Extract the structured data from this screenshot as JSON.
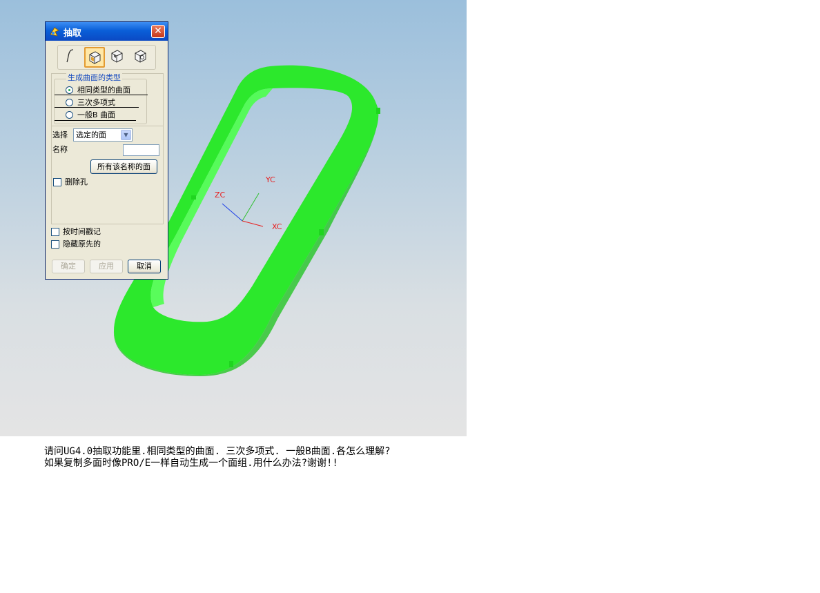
{
  "dialog": {
    "title": "抽取",
    "close_glyph": "✕",
    "toolbar": {
      "icons": [
        "curve-icon",
        "face-icon",
        "face-region-icon",
        "body-icon"
      ],
      "selected_index": 1
    },
    "surface_type": {
      "group_title": "生成曲面的类型",
      "options": [
        {
          "label": "相同类型的曲面",
          "checked": true
        },
        {
          "label": "三次多项式",
          "checked": false
        },
        {
          "label": "一般B 曲面",
          "checked": false
        }
      ]
    },
    "select_label": "选择",
    "select_value": "选定的面",
    "name_label": "名称",
    "name_value": "",
    "all_named_faces_button": "所有该名称的面",
    "delete_holes": {
      "label": "删除孔",
      "checked": false
    },
    "timestamp": {
      "label": "按时间戳记",
      "checked": false
    },
    "hide_original": {
      "label": "隐藏原先的",
      "checked": false
    },
    "buttons": {
      "ok": "确定",
      "apply": "应用",
      "cancel": "取消"
    }
  },
  "viewport": {
    "axes": {
      "x": "XC",
      "y": "YC",
      "z": "ZC"
    },
    "part_color": "#22ee22",
    "axis_colors": {
      "x": "#e81c1c",
      "y": "#2fbf2f",
      "z": "#1c3ee8"
    }
  },
  "question": {
    "line1": "请问UG4.0抽取功能里.相同类型的曲面. 三次多项式. 一般B曲面.各怎么理解?",
    "line2": "如果复制多面时像PRO/E一样自动生成一个面组.用什么办法?谢谢!!"
  }
}
